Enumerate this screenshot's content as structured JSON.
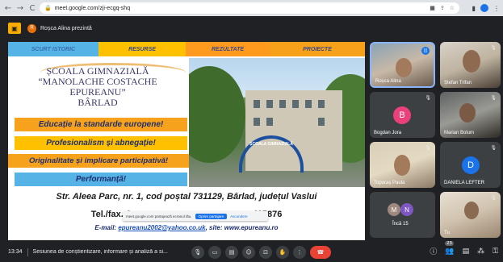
{
  "browser": {
    "url": "meet.google.com/zji-ecgq-shq",
    "nav": {
      "back": "←",
      "forward": "→",
      "reload": "C"
    }
  },
  "meet_top": {
    "presenter_initial": "R",
    "presenter_text": "Roșca Alina prezintă"
  },
  "slide": {
    "tabs": [
      "SCURT ISTORIC",
      "RESURSE",
      "REZULTATE",
      "PROIECTE"
    ],
    "school_name": [
      "ȘCOALA GIMNAZIALĂ",
      "“MANOLACHE COSTACHE",
      "EPUREANU”",
      "BÂRLAD"
    ],
    "slogans": [
      "Educație la standarde europene!",
      "Profesionalism și abnegație!",
      "Originalitate și implicare participativă!",
      "Performanță!"
    ],
    "photo_sign": "ȘCOALA GIMNAZIALĂ",
    "address": "Str. Aleea Parc, nr. 1, cod poștal 731129, Bârlad, județul Vaslui",
    "tel_prefix": "Tel./fax.:0",
    "tel_suffix": "415876",
    "email_prefix": "E-mail: ",
    "email": "epureanu2002@yahoo.co.uk",
    "site": ", site: www.epureanu.ro"
  },
  "sharing_bar": {
    "message": "meet.google.com partajează ecranul tău.",
    "stop_label": "Oprire partajare",
    "hide_label": "Ascundere"
  },
  "participants": [
    {
      "name": "Roșca Alina",
      "initial": ""
    },
    {
      "name": "Ștefan Trifan",
      "initial": ""
    },
    {
      "name": "Bogdan Jora",
      "initial": "B",
      "color": "#ec407a"
    },
    {
      "name": "Marian Bolum",
      "initial": ""
    },
    {
      "name": "Toporaș Paula",
      "initial": ""
    },
    {
      "name": "DANIELA LEFTER",
      "initial": "D",
      "color": "#1a73e8"
    },
    {
      "name": "Încă 15",
      "initials": [
        "M",
        "N"
      ],
      "colors": [
        "#a1887f",
        "#7e57c2"
      ]
    },
    {
      "name": "Tu",
      "initial": ""
    }
  ],
  "bottom": {
    "time": "13:34",
    "meeting_title": "Sesiunea de conștientizare, informare și analiză a si...",
    "participant_count": "23"
  },
  "colors": {
    "end_call": "#ea4335",
    "accent": "#1a73e8"
  }
}
